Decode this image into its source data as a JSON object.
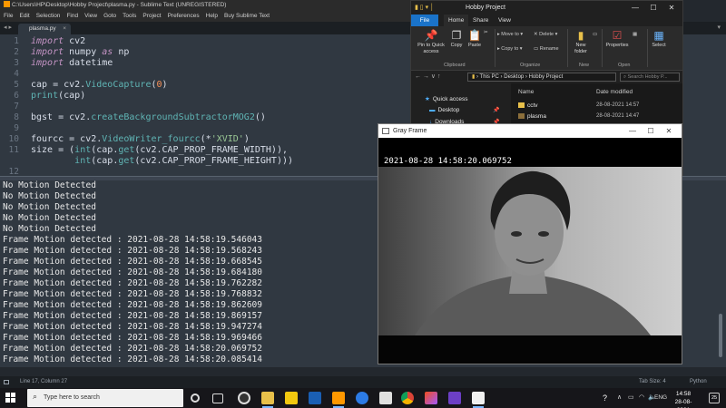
{
  "sublime": {
    "title": "C:\\Users\\HP\\Desktop\\Hobby Project\\plasma.py - Sublime Text (UNREGISTERED)",
    "menu": [
      "File",
      "Edit",
      "Selection",
      "Find",
      "View",
      "Goto",
      "Tools",
      "Project",
      "Preferences",
      "Help",
      "Buy Sublime Text",
      "Beta"
    ],
    "tab": "plasma.py",
    "code": [
      {
        "n": "1",
        "segs": [
          {
            "t": "import",
            "c": "kw"
          },
          {
            "t": " cv2",
            "c": ""
          }
        ]
      },
      {
        "n": "2",
        "segs": [
          {
            "t": "import",
            "c": "kw"
          },
          {
            "t": " numpy ",
            "c": ""
          },
          {
            "t": "as",
            "c": "kw"
          },
          {
            "t": " np",
            "c": ""
          }
        ]
      },
      {
        "n": "3",
        "segs": [
          {
            "t": "import",
            "c": "kw"
          },
          {
            "t": " datetime",
            "c": ""
          }
        ]
      },
      {
        "n": "4",
        "segs": []
      },
      {
        "n": "5",
        "segs": [
          {
            "t": "cap = cv2.",
            "c": ""
          },
          {
            "t": "VideoCapture",
            "c": "fn"
          },
          {
            "t": "(",
            "c": ""
          },
          {
            "t": "0",
            "c": "num"
          },
          {
            "t": ")",
            "c": ""
          }
        ]
      },
      {
        "n": "6",
        "segs": [
          {
            "t": "print",
            "c": "fn"
          },
          {
            "t": "(cap)",
            "c": ""
          }
        ]
      },
      {
        "n": "7",
        "segs": []
      },
      {
        "n": "8",
        "segs": [
          {
            "t": "bgst = cv2.",
            "c": ""
          },
          {
            "t": "createBackgroundSubtractorMOG2",
            "c": "fn"
          },
          {
            "t": "()",
            "c": ""
          }
        ]
      },
      {
        "n": "9",
        "segs": []
      },
      {
        "n": "10",
        "segs": [
          {
            "t": "fourcc = cv2.",
            "c": ""
          },
          {
            "t": "VideoWriter_fourcc",
            "c": "fn"
          },
          {
            "t": "(*",
            "c": ""
          },
          {
            "t": "'XVID'",
            "c": "str"
          },
          {
            "t": ")",
            "c": ""
          }
        ]
      },
      {
        "n": "11",
        "segs": [
          {
            "t": "size = (",
            "c": ""
          },
          {
            "t": "int",
            "c": "fn"
          },
          {
            "t": "(cap.",
            "c": ""
          },
          {
            "t": "get",
            "c": "fn"
          },
          {
            "t": "(cv2.CAP_PROP_FRAME_WIDTH)),",
            "c": ""
          }
        ]
      },
      {
        "n": "",
        "segs": [
          {
            "t": "        ",
            "c": ""
          },
          {
            "t": "int",
            "c": "fn"
          },
          {
            "t": "(cap.",
            "c": ""
          },
          {
            "t": "get",
            "c": "fn"
          },
          {
            "t": "(cv2.CAP_PROP_FRAME_HEIGHT)))",
            "c": ""
          }
        ]
      },
      {
        "n": "12",
        "segs": []
      }
    ],
    "console": [
      "No Motion Detected",
      "No Motion Detected",
      "No Motion Detected",
      "No Motion Detected",
      "No Motion Detected",
      "Frame Motion detected : 2021-08-28 14:58:19.546043",
      "Frame Motion detected : 2021-08-28 14:58:19.568243",
      "Frame Motion detected : 2021-08-28 14:58:19.668545",
      "Frame Motion detected : 2021-08-28 14:58:19.684180",
      "Frame Motion detected : 2021-08-28 14:58:19.762282",
      "Frame Motion detected : 2021-08-28 14:58:19.768832",
      "Frame Motion detected : 2021-08-28 14:58:19.862609",
      "Frame Motion detected : 2021-08-28 14:58:19.869157",
      "Frame Motion detected : 2021-08-28 14:58:19.947274",
      "Frame Motion detected : 2021-08-28 14:58:19.969466",
      "Frame Motion detected : 2021-08-28 14:58:20.069752",
      "Frame Motion detected : 2021-08-28 14:58:20.085414"
    ],
    "status_position": "Line 17, Column 27",
    "status_tabsize": "Tab Size: 4",
    "status_syntax": "Python"
  },
  "explorer": {
    "title": "Hobby Project",
    "ribbon_tabs": {
      "file": "File",
      "home": "Home",
      "share": "Share",
      "view": "View"
    },
    "ribbon": {
      "pin": "Pin to Quick access",
      "copy": "Copy",
      "paste": "Paste",
      "move_to": "Move to",
      "copy_to": "Copy to",
      "delete": "Delete",
      "rename": "Rename",
      "new_folder": "New folder",
      "properties": "Properties",
      "select": "Select"
    },
    "groups": {
      "clipboard": "Clipboard",
      "organize": "Organize",
      "new": "New",
      "open": "Open"
    },
    "path": [
      "This PC",
      "Desktop",
      "Hobby Project"
    ],
    "search_placeholder": "Search Hobby P...",
    "nav": [
      {
        "label": "Quick access"
      },
      {
        "label": "Desktop"
      },
      {
        "label": "Downloads"
      }
    ],
    "columns": {
      "name": "Name",
      "date": "Date modified"
    },
    "files": [
      {
        "name": "cctv",
        "date": "28-08-2021 14:57"
      },
      {
        "name": "plasma",
        "date": "28-08-2021 14:47"
      }
    ]
  },
  "gray_frame": {
    "title": "Gray Frame",
    "timestamp": "2021-08-28 14:58:20.069752"
  },
  "taskbar": {
    "search_placeholder": "Type here to search",
    "language": "ENG",
    "time": "14:58",
    "date": "28-08-2021",
    "notifications": "25"
  },
  "colors": {
    "editor_bg": "#303841",
    "keyword": "#c594c5",
    "function": "#5fb4b4",
    "number": "#f99157",
    "string": "#99c794",
    "explorer_accent": "#1a73c9"
  }
}
